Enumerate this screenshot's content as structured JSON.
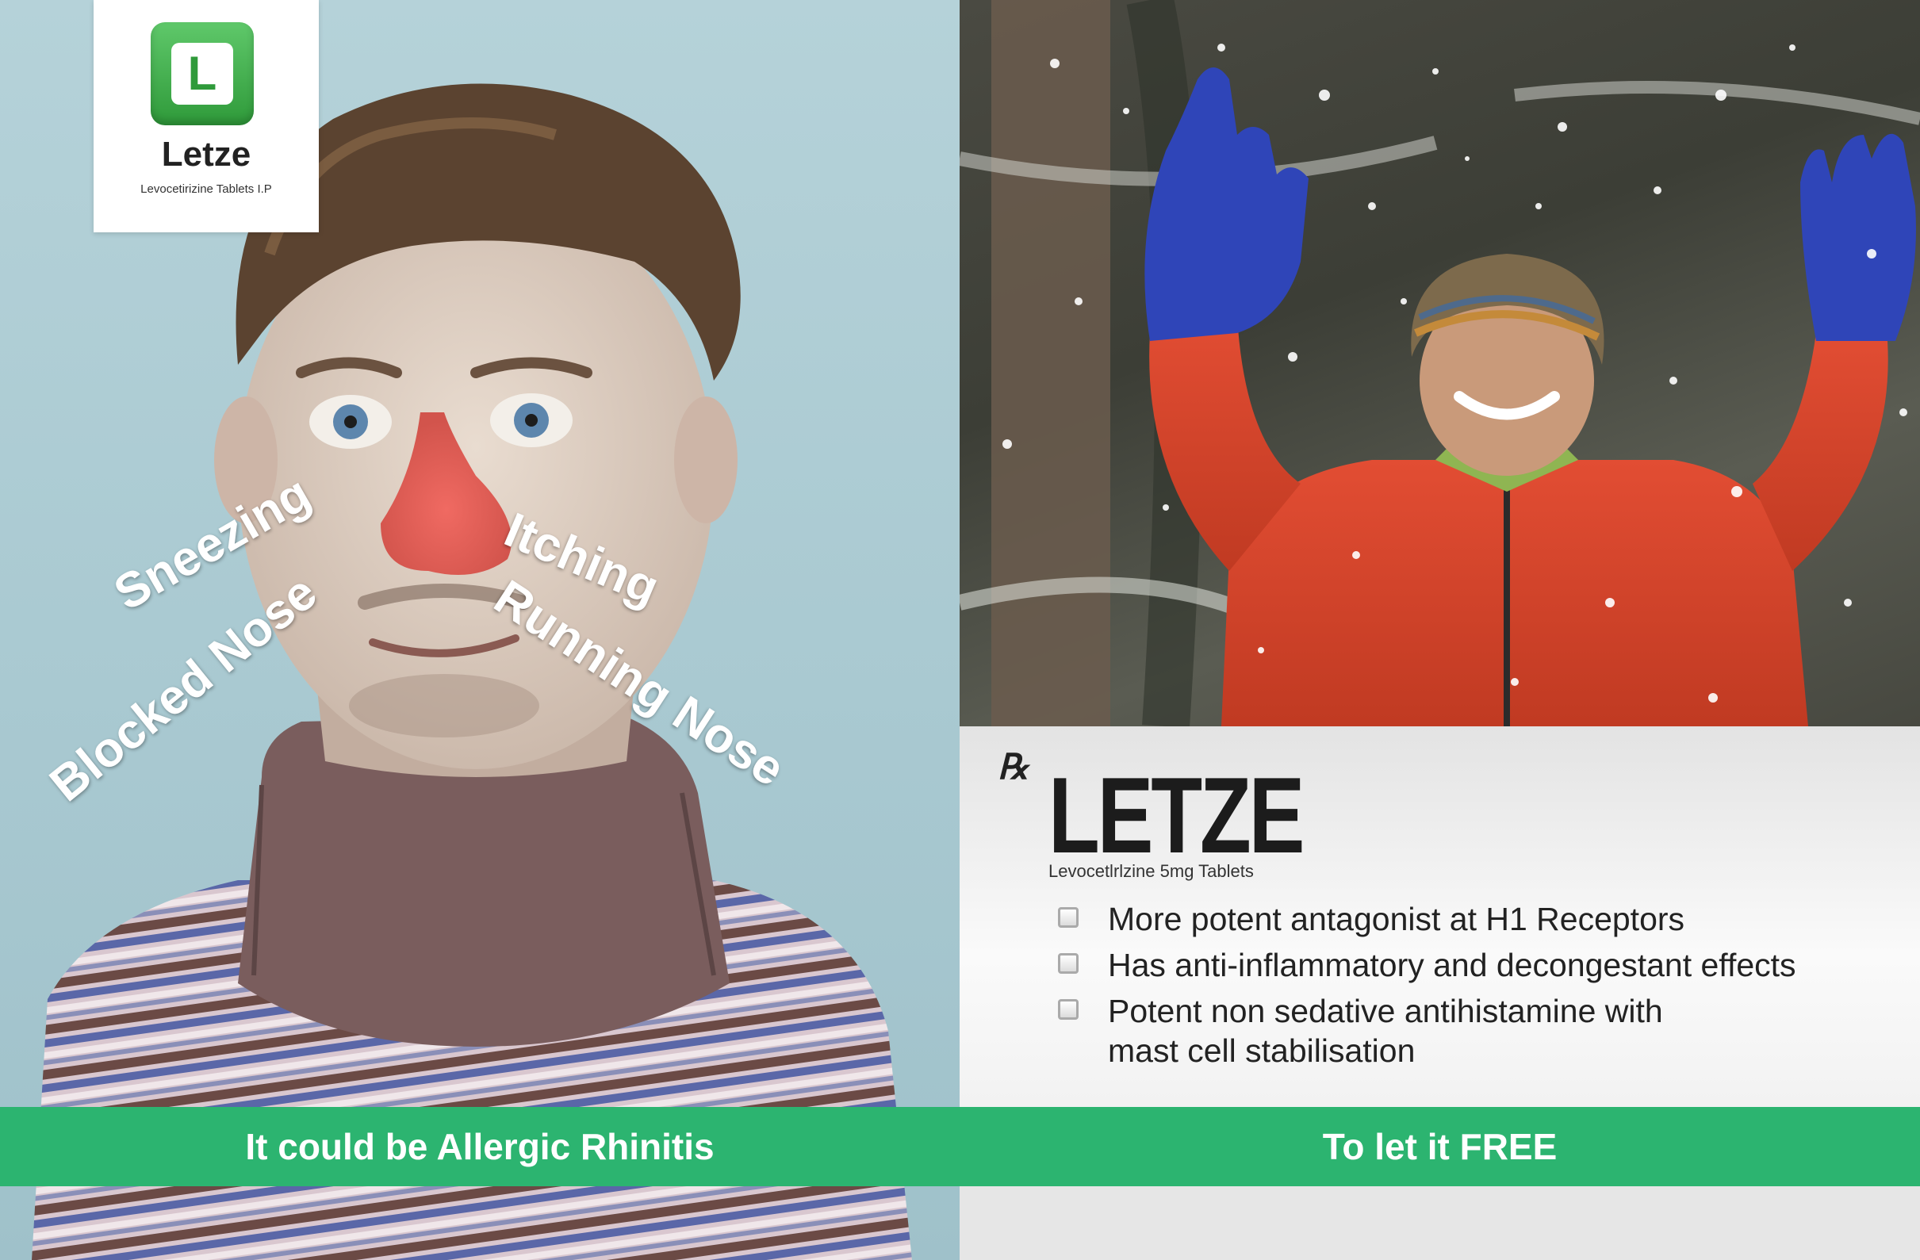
{
  "logo": {
    "name": "Letze",
    "letter": "L",
    "subtitle": "Levocetirizine Tablets I.P"
  },
  "symptoms": {
    "sneezing": "Sneezing",
    "blocked": "Blocked Nose",
    "itching": "Itching",
    "running": "Running Nose"
  },
  "left_band": "It could be Allergic Rhinitis",
  "right_band": "To let it FREE",
  "product": {
    "rx": "℞",
    "brand": "LETZE",
    "subtitle": "Levocetlrlzine 5mg Tablets",
    "features": [
      "More potent antagonist at H1 Receptors",
      "Has anti-inflammatory and decongestant effects",
      "Potent non sedative antihistamine with mast cell stabilisation"
    ]
  },
  "colors": {
    "band_green": "#2cb470",
    "logo_green": "#2f9a3a",
    "jacket_red": "#d8432a",
    "glove_blue": "#2f45b8"
  }
}
